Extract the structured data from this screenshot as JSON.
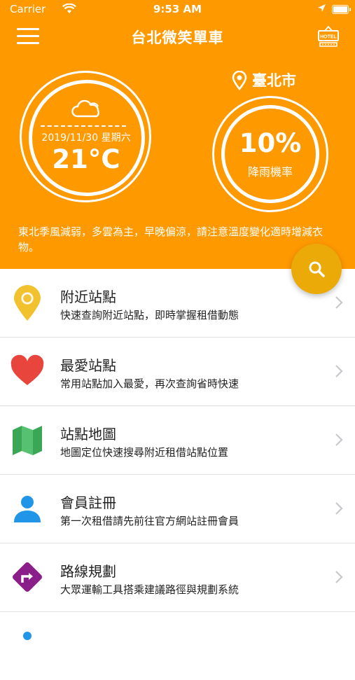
{
  "status_bar": {
    "carrier": "Carrier",
    "time": "9:53 AM"
  },
  "header": {
    "title": "台北微笑單車",
    "hotel_badge": "HOTEL",
    "accent_color": "#ff9900"
  },
  "weather": {
    "date": "2019/11/30 星期六",
    "temperature": "21°C",
    "city": "臺北市",
    "rain_percent": "10%",
    "rain_label": "降雨機率",
    "forecast": "東北季風減弱，多雲為主，早晚偏涼，請注意溫度變化適時增減衣物。"
  },
  "menu": [
    {
      "title": "附近站點",
      "desc": "快速查詢附近站點，即時掌握租借動態",
      "icon": "location-pin-icon"
    },
    {
      "title": "最愛站點",
      "desc": "常用站點加入最愛，再次查詢省時快速",
      "icon": "heart-icon"
    },
    {
      "title": "站點地圖",
      "desc": "地圖定位快速搜尋附近租借站點位置",
      "icon": "map-icon"
    },
    {
      "title": "會員註冊",
      "desc": "第一次租借請先前往官方網站註冊會員",
      "icon": "person-icon"
    },
    {
      "title": "路線規劃",
      "desc": "大眾運輸工具搭乘建議路徑與規劃系統",
      "icon": "route-sign-icon"
    }
  ]
}
